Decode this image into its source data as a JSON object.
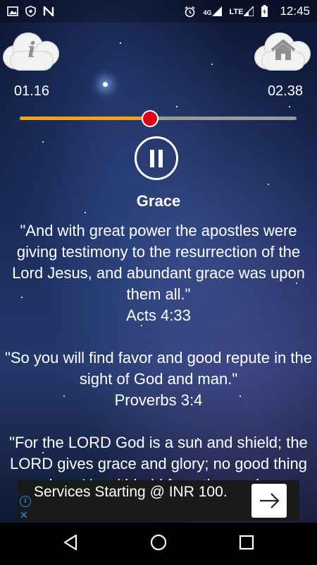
{
  "status_bar": {
    "icons_left": [
      "image-icon",
      "vpn-shield-icon",
      "n-app-icon"
    ],
    "icons_right": [
      "alarm-icon",
      "4g-signal-icon",
      "lte-signal-icon",
      "battery-charging-icon"
    ],
    "network_4g": "4G",
    "network_lte": "LTE",
    "time": "12:45"
  },
  "buttons": {
    "info_glyph": "i",
    "home_icon": "home-icon"
  },
  "player": {
    "elapsed": "01.16",
    "total": "02.38",
    "progress_fraction": 0.47,
    "title": "Grace"
  },
  "verses": [
    {
      "text": "\"And with great power the apostles were giving testimony to the resurrection of the Lord Jesus, and abundant grace was upon them all.\"",
      "ref": "Acts 4:33"
    },
    {
      "text": "\"So you will find favor and good repute in the sight of God and man.\"",
      "ref": "Proverbs 3:4"
    },
    {
      "text": "\"For the LORD God is a sun and shield; the LORD gives grace and glory; no good thing does He withhold from those who",
      "ref": ""
    }
  ],
  "ad": {
    "text": "Services Starting @ INR 100.",
    "info_glyph": "i",
    "close_glyph": "✕",
    "arrow_glyph": "→"
  },
  "colors": {
    "progress": "#f5a21b",
    "thumb": "#e0001a",
    "track": "#9a9a9a",
    "ad_accent": "#2a8fdc"
  }
}
